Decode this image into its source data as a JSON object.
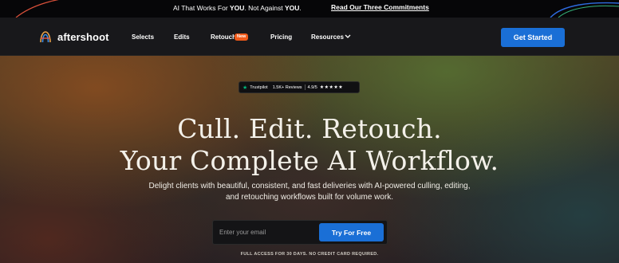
{
  "announcement": {
    "prefix": "AI That Works For ",
    "you1": "YOU",
    "middle": ". Not Against ",
    "you2": "YOU",
    "suffix": ".",
    "link": "Read Our Three Commitments"
  },
  "nav": {
    "brand": "aftershoot",
    "items": [
      "Selects",
      "Edits",
      "Retouch",
      "Pricing",
      "Resources"
    ],
    "retouch_badge": "New",
    "cta": "Get Started"
  },
  "hero": {
    "trust": {
      "brand": "Trustpilot",
      "reviews": "1.5K+ Reviews",
      "rating": "4.9/5",
      "stars": "★★★★★"
    },
    "title_line1": "Cull. Edit. Retouch.",
    "title_line2": "Your Complete AI Workflow.",
    "subtitle_line1": "Delight clients with beautiful, consistent, and fast deliveries with AI-powered culling, editing,",
    "subtitle_line2": "and retouching workflows built for volume work.",
    "email_placeholder": "Enter your email",
    "button": "Try For Free",
    "note": "FULL ACCESS FOR 30 DAYS. NO CREDIT CARD REQUIRED."
  },
  "colors": {
    "accent": "#1a6fd6",
    "badge": "#f05a1a",
    "trustpilot": "#00b67a"
  }
}
